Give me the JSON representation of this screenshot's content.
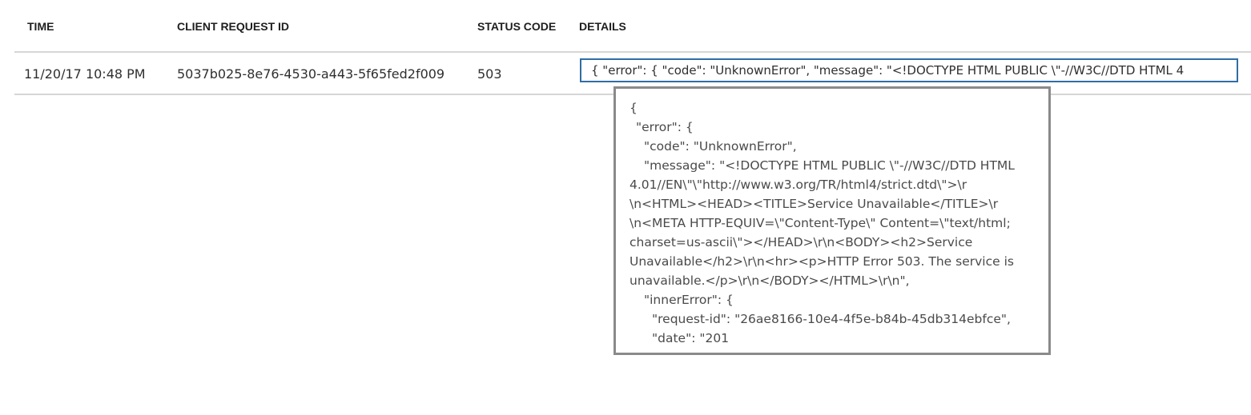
{
  "table": {
    "headers": {
      "time": "TIME",
      "client_request_id": "CLIENT REQUEST ID",
      "status_code": "STATUS CODE",
      "details": "DETAILS"
    },
    "rows": [
      {
        "time": "11/20/17 10:48 PM",
        "client_request_id": "5037b025-8e76-4530-a443-5f65fed2f009",
        "status_code": "503",
        "details_preview": "{  \"error\": {    \"code\": \"UnknownError\",    \"message\": \"<!DOCTYPE HTML PUBLIC \\\"-//W3C//DTD HTML 4"
      }
    ]
  },
  "tooltip": {
    "lines": [
      "{",
      "  \"error\": {",
      "    \"code\": \"UnknownError\",",
      "    \"message\": \"<!DOCTYPE HTML PUBLIC \\\"-//W3C//DTD HTML",
      "4.01//EN\\\"\\\"http://www.w3.org/TR/html4/strict.dtd\\\">\\r",
      "\\n<HTML><HEAD><TITLE>Service Unavailable</TITLE>\\r",
      "\\n<META HTTP-EQUIV=\\\"Content-Type\\\" Content=\\\"text/html;",
      "charset=us-ascii\\\"></HEAD>\\r\\n<BODY><h2>Service",
      "Unavailable</h2>\\r\\n<hr><p>HTTP Error 503. The service is",
      "unavailable.</p>\\r\\n</BODY></HTML>\\r\\n\",",
      "    \"innerError\": {",
      "      \"request-id\": \"26ae8166-10e4-4f5e-b84b-45db314ebfce\",",
      "      \"date\": \"201"
    ]
  }
}
